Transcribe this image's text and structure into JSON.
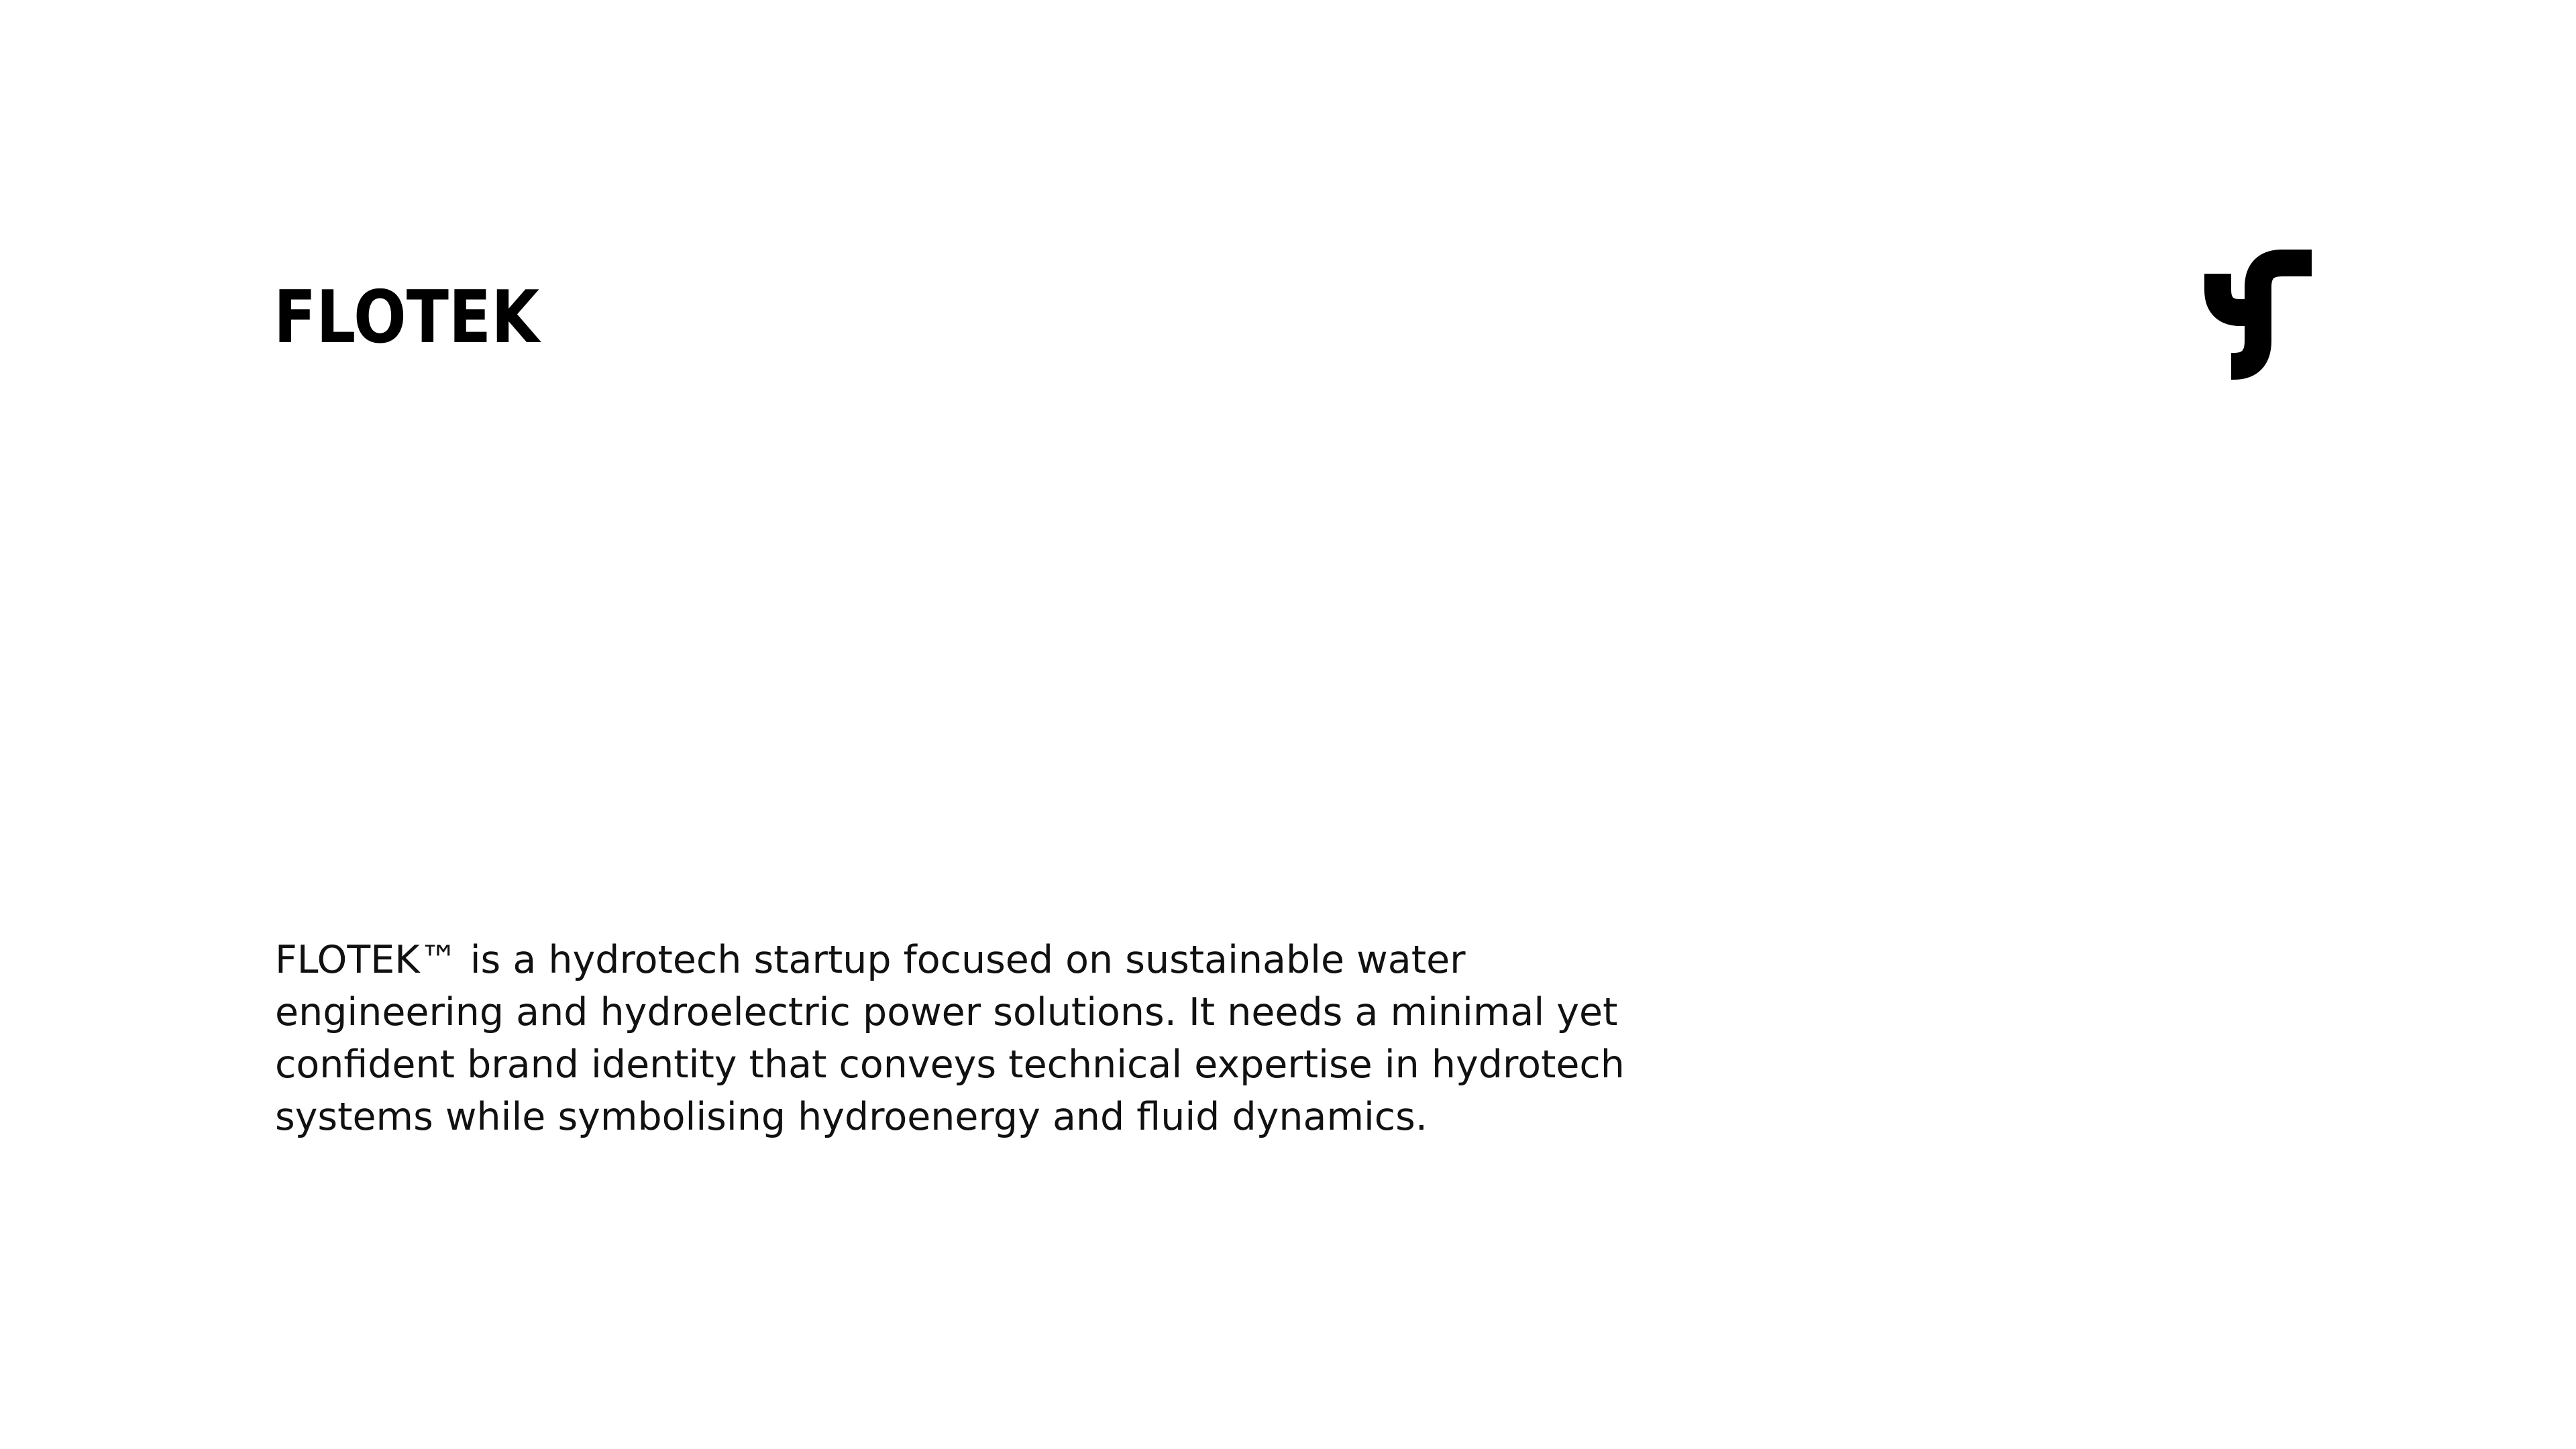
{
  "brand": {
    "wordmark": "FLOTEK",
    "mark_icon": "flotek-pipe-mark-icon",
    "color": "#000000"
  },
  "description": {
    "lines": [
      "FLOTEK™ is a hydrotech startup focused on sustainable water",
      "engineering and hydroelectric power solutions. It needs a minimal yet",
      "confident brand identity that conveys technical expertise in hydrotech",
      "systems while symbolising hydroenergy and fluid dynamics."
    ],
    "color": "#111111"
  },
  "page": {
    "background": "#ffffff"
  }
}
